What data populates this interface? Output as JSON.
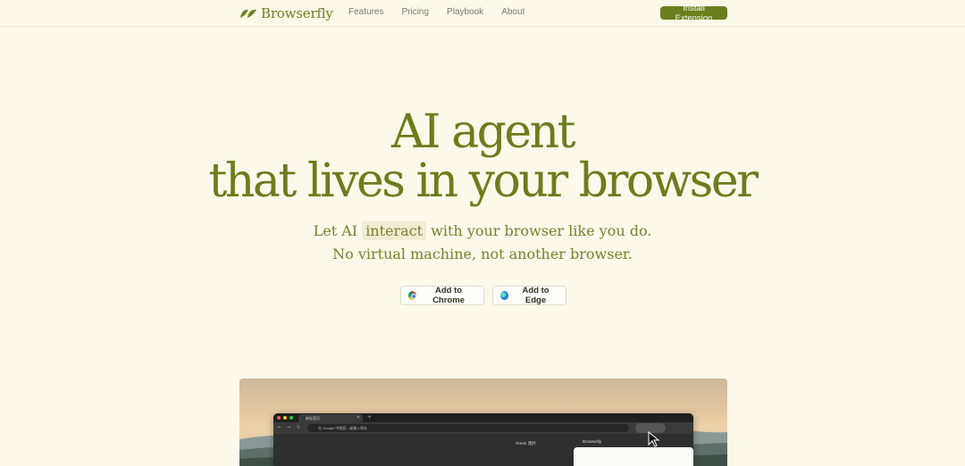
{
  "header": {
    "brand": "Browserfly",
    "nav": [
      "Features",
      "Pricing",
      "Playbook",
      "About"
    ],
    "install_label": "Install Extension"
  },
  "hero": {
    "title_line1": "AI agent",
    "title_line2": "that lives in your browser",
    "subtitle_pre": "Let AI ",
    "subtitle_highlight": "interact",
    "subtitle_post": " with your browser like you do.",
    "subtitle_line2": "No virtual machine, not another browser."
  },
  "cta": {
    "chrome_label": "Add to Chrome",
    "edge_label": "Add to Edge"
  },
  "demo": {
    "tab_title": "新标签页",
    "address_text": "在 Google 中搜索，或输入网址",
    "gmail_label": "Gmail",
    "images_label": "图片",
    "panel_title": "Browserfly"
  },
  "colors": {
    "background": "#fcf8ea",
    "brand_green": "#6d7c1c",
    "button_green": "#6b7f1f"
  }
}
